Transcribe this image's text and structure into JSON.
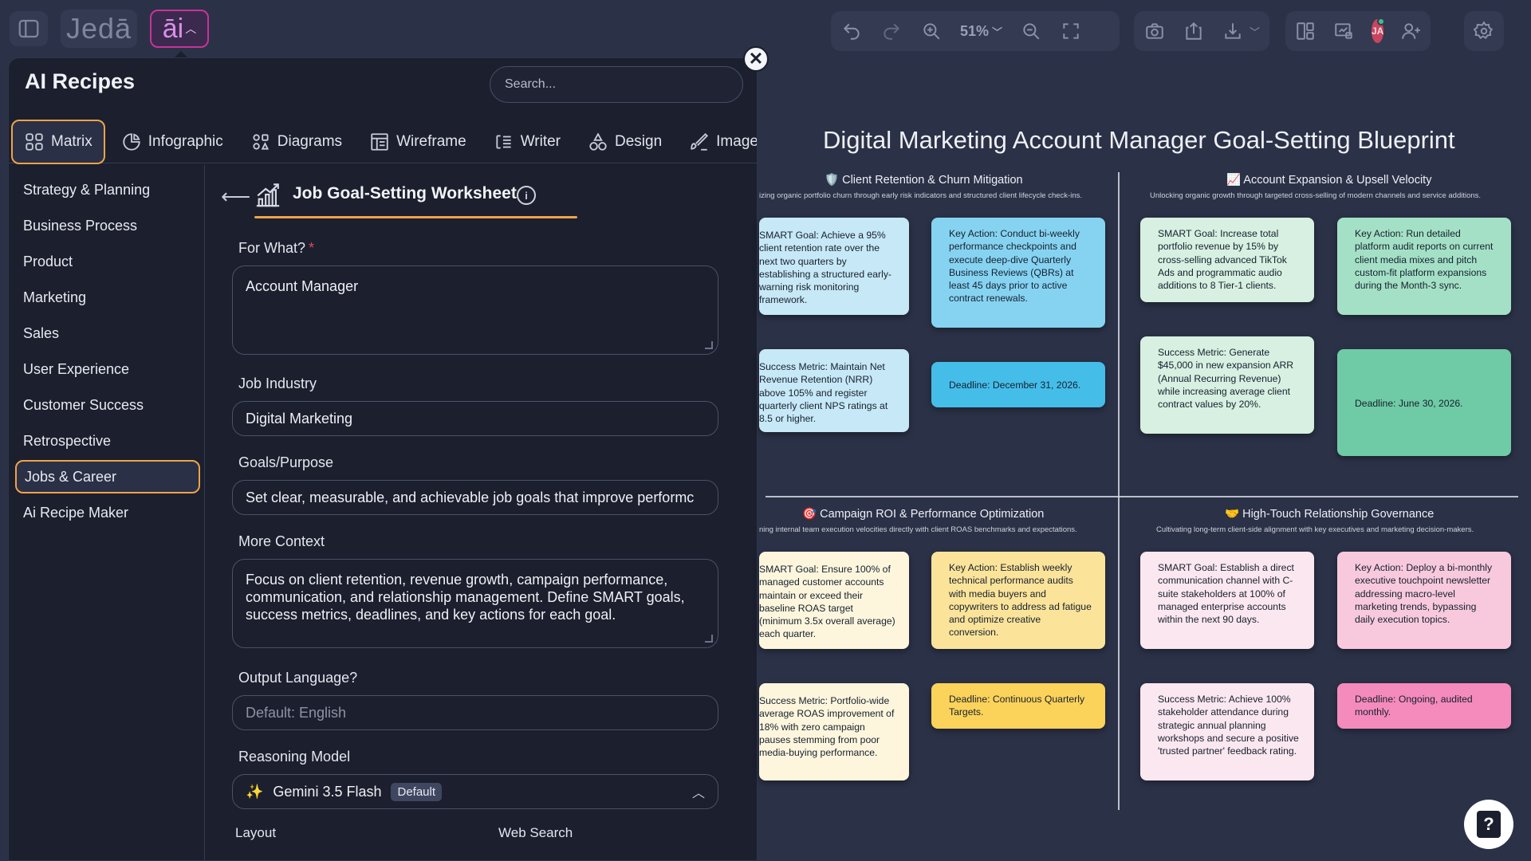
{
  "topbar": {
    "brand": "Jedā",
    "ai_label": "āi",
    "zoom": "51%"
  },
  "user": {
    "initials": "JA"
  },
  "panel": {
    "title": "AI Recipes",
    "search_placeholder": "Search...",
    "close_glyph": "✕",
    "tabs": [
      {
        "label": "Matrix",
        "icon": "matrix-grid-icon",
        "active": true
      },
      {
        "label": "Infographic",
        "icon": "pie-chart-icon"
      },
      {
        "label": "Diagrams",
        "icon": "diagram-nodes-icon"
      },
      {
        "label": "Wireframe",
        "icon": "wireframe-icon"
      },
      {
        "label": "Writer",
        "icon": "text-lines-icon"
      },
      {
        "label": "Design",
        "icon": "shapes-icon"
      },
      {
        "label": "Image",
        "icon": "image-brush-icon"
      }
    ],
    "categories": [
      "Strategy & Planning",
      "Business Process",
      "Product",
      "Marketing",
      "Sales",
      "User Experience",
      "Customer Success",
      "Retrospective",
      "Jobs & Career",
      "Ai Recipe Maker"
    ],
    "active_category": "Jobs & Career"
  },
  "form": {
    "back_glyph": "⟵",
    "title": "Job Goal-Setting Worksheet",
    "info_glyph": "i",
    "for_what_label": "For What?",
    "required_mark": "*",
    "for_what_value": "Account Manager",
    "industry_label": "Job Industry",
    "industry_value": "Digital Marketing",
    "goals_label": "Goals/Purpose",
    "goals_value": "Set clear, measurable, and achievable job goals that improve performc",
    "context_label": "More Context",
    "context_value": "Focus on client retention, revenue growth, campaign performance, communication, and relationship management. Define SMART goals, success metrics, deadlines, and key actions for each goal.",
    "language_label": "Output Language?",
    "language_placeholder": "Default: English",
    "model_label": "Reasoning Model",
    "model_value": "Gemini 3.5 Flash",
    "model_badge": "Default",
    "layout_label": "Layout",
    "web_search_label": "Web Search"
  },
  "board": {
    "title": "Digital Marketing Account Manager Goal-Setting Blueprint",
    "quadrants": [
      {
        "title": "Client Retention & Churn Mitigation",
        "icon": "shield-icon",
        "subtitle": "izing organic portfolio churn through early risk indicators and structured client lifecycle check-ins.",
        "notes": [
          "SMART Goal: Achieve a 95% client retention rate over the next two quarters by establishing a structured early-warning risk monitoring framework.",
          "Key Action: Conduct bi-weekly performance checkpoints and execute deep-dive Quarterly Business Reviews (QBRs) at least 45 days prior to active contract renewals.",
          "Success Metric: Maintain Net Revenue Retention (NRR) above 105% and register quarterly client NPS ratings at 8.5 or higher.",
          "Deadline: December 31, 2026."
        ]
      },
      {
        "title": "Account Expansion & Upsell Velocity",
        "icon": "chart-up-icon",
        "subtitle": "Unlocking organic growth through targeted cross-selling of modern channels and service additions.",
        "notes": [
          "SMART Goal: Increase total portfolio revenue by 15% by cross-selling advanced TikTok Ads and programmatic audio additions to 8 Tier-1 clients.",
          "Key Action: Run detailed platform audit reports on current client media mixes and pitch custom-fit platform expansions during the Month-3 sync.",
          "Success Metric: Generate $45,000 in new expansion ARR (Annual Recurring Revenue) while increasing average client contract values by 20%.",
          "Deadline: June 30, 2026."
        ]
      },
      {
        "title": "Campaign ROI & Performance Optimization",
        "icon": "target-icon",
        "subtitle": "ning internal team execution velocities directly with client ROAS benchmarks and expectations.",
        "notes": [
          "SMART Goal: Ensure 100% of managed customer accounts maintain or exceed their baseline ROAS target (minimum 3.5x overall average) each quarter.",
          "Key Action: Establish weekly technical performance audits with media buyers and copywriters to address ad fatigue and optimize creative conversion.",
          "Success Metric: Portfolio-wide average ROAS improvement of 18% with zero campaign pauses stemming from poor media-buying performance.",
          "Deadline: Continuous Quarterly Targets."
        ]
      },
      {
        "title": "High-Touch Relationship Governance",
        "icon": "handshake-icon",
        "subtitle": "Cultivating long-term client-side alignment with key executives and marketing decision-makers.",
        "notes": [
          "SMART Goal: Establish a direct communication channel with C-suite stakeholders at 100% of managed enterprise accounts within the next 90 days.",
          "Key Action: Deploy a bi-monthly executive touchpoint newsletter addressing macro-level marketing trends, bypassing daily execution topics.",
          "Success Metric: Achieve 100% stakeholder attendance during strategic annual planning workshops and secure a positive 'trusted partner' feedback rating.",
          "Deadline: Ongoing, audited monthly."
        ]
      }
    ]
  },
  "help": {
    "glyph": "?"
  },
  "colors": {
    "accent": "#f0a24a",
    "panel_bg": "#1b1f2e",
    "canvas_bg": "#2b3147",
    "ai_button_border": "#c5349a"
  }
}
